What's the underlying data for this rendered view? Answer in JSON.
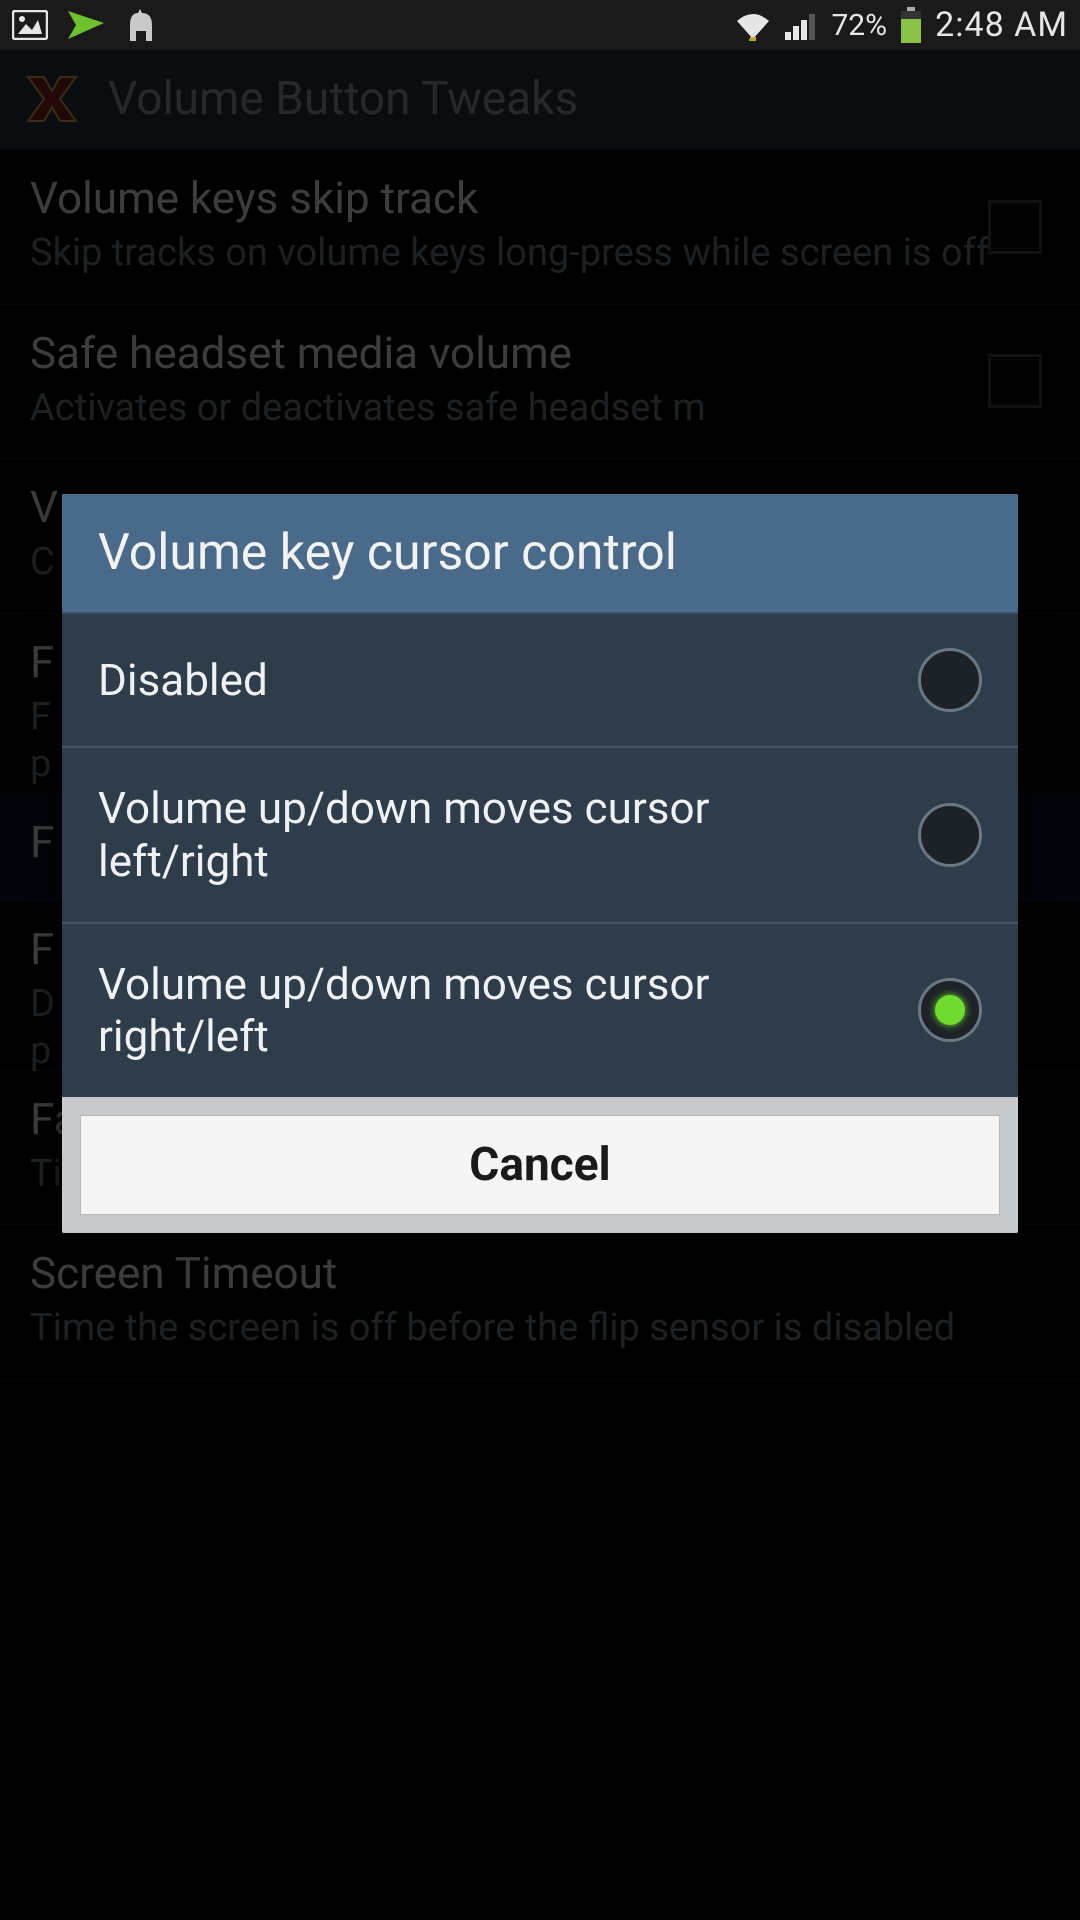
{
  "status": {
    "battery_pct": "72%",
    "time": "2:48 AM"
  },
  "actionbar": {
    "title": "Volume Button Tweaks"
  },
  "settings": [
    {
      "title": "Volume keys skip track",
      "sub": "Skip tracks on volume keys long-press while screen is off",
      "checkbox": true
    },
    {
      "title": "Safe headset media volume",
      "sub": "Activates or deactivates safe headset m",
      "checkbox": true
    },
    {
      "title": "V",
      "sub": "C",
      "checkbox": false
    },
    {
      "title": "F",
      "sub": "F\np",
      "checkbox": false
    },
    {
      "title": "F",
      "sub": "",
      "checkbox": false
    },
    {
      "title": "F",
      "sub": "D\np",
      "checkbox": false
    },
    {
      "title": "Face down seconds",
      "sub": "Time required for your phone to be considered face down",
      "checkbox": false
    },
    {
      "title": "Screen Timeout",
      "sub": "Time the screen is off before the flip sensor is disabled",
      "checkbox": false
    }
  ],
  "dialog": {
    "title": "Volume key cursor control",
    "options": [
      {
        "label": "Disabled",
        "selected": false
      },
      {
        "label": "Volume up/down moves cursor left/right",
        "selected": false
      },
      {
        "label": "Volume up/down moves cursor right/left",
        "selected": true
      }
    ],
    "cancel": "Cancel"
  },
  "colors": {
    "accent_green": "#8bc34a",
    "send_green": "#6ec12c",
    "battery_green": "#8bc34a",
    "dialog_header": "#4a6a8a"
  }
}
